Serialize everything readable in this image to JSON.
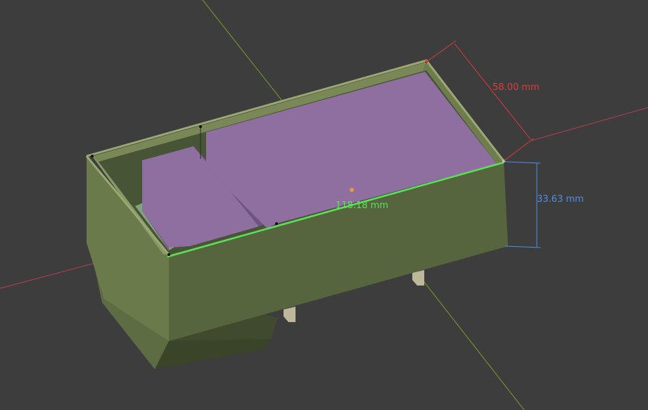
{
  "viewport": {
    "background": "#3d3d3d",
    "dimensions": {
      "depth": {
        "text": "58.00 mm",
        "color": "#e03a3a"
      },
      "height": {
        "text": "33.63 mm",
        "color": "#4d8fe0"
      },
      "length": {
        "text": "118.18 mm",
        "color": "#5ce05c"
      }
    },
    "axes": {
      "x_color": "#a0404a",
      "y_color": "#6e8f2e"
    },
    "mesh_colors": {
      "container": "#5a6a42",
      "inner_blocks": "#8e6fa0",
      "selected_edge": "#5ce05c"
    }
  }
}
